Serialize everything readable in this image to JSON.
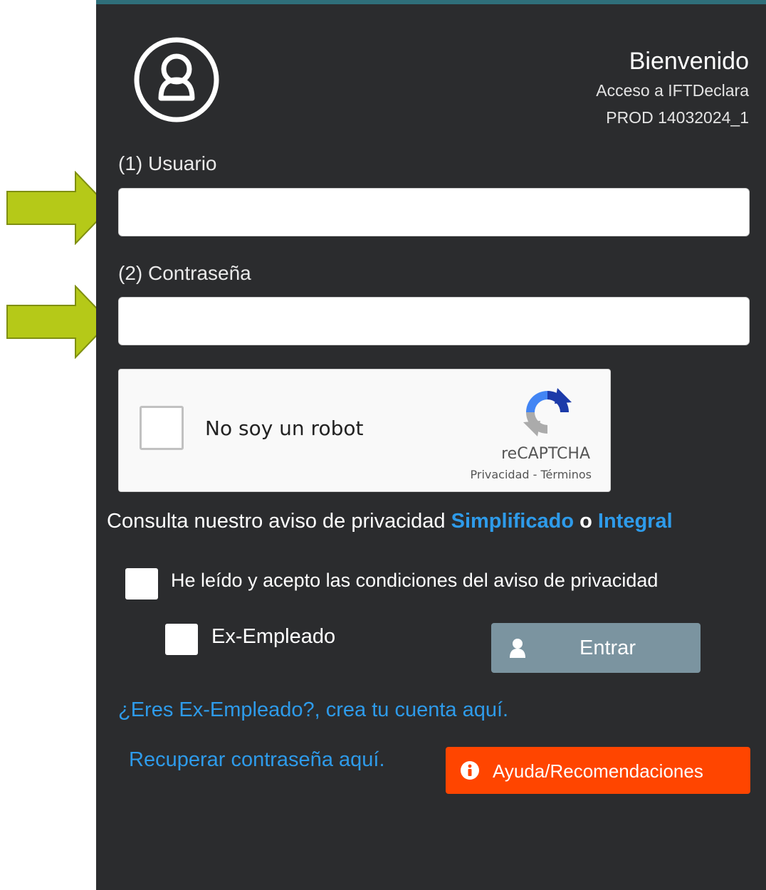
{
  "header": {
    "title": "Bienvenido",
    "subtitle": "Acceso a IFTDeclara",
    "version": "PROD 14032024_1",
    "avatar_icon": "user-circle-icon"
  },
  "form": {
    "username_label": "(1) Usuario",
    "username_value": "",
    "password_label": "(2) Contraseña",
    "password_value": ""
  },
  "captcha": {
    "label": "No soy un robot",
    "brand": "reCAPTCHA",
    "privacy": "Privacidad",
    "separator": " - ",
    "terms": "Términos",
    "logo_icon": "recaptcha-logo-icon"
  },
  "privacy": {
    "text": "Consulta nuestro aviso de privacidad",
    "simplified_link": "Simplificado",
    "conjunction": "o",
    "integral_link": "Integral",
    "accept_label": "He leído y acepto las condiciones del aviso de privacidad"
  },
  "ex_employee": {
    "label": "Ex-Empleado"
  },
  "buttons": {
    "login": "Entrar",
    "login_icon": "user-icon",
    "help": "Ayuda/Recomendaciones",
    "help_icon": "info-circle-icon"
  },
  "links": {
    "create_account": "¿Eres Ex-Empleado?, crea tu cuenta aquí.",
    "recover_password": "Recuperar contraseña aquí."
  },
  "colors": {
    "panel_background": "#2b2c2e",
    "link": "#2e9bea",
    "login_button": "#7b94a0",
    "help_button": "#ff4500",
    "annotation_arrow": "#b5c918"
  }
}
